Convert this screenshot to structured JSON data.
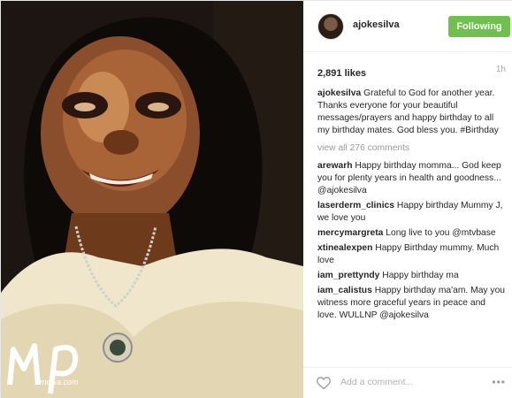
{
  "post": {
    "username": "ajokesilva",
    "follow_label": "Following",
    "likes": "2,891 likes",
    "time": "1h"
  },
  "caption": {
    "user": "ajokesilva",
    "text": "Grateful to God for another year. Thanks everyone for your beautiful messages/prayers and happy birthday to all my birthday mates. God bless you. #Birthday"
  },
  "view_all": "view all 276 comments",
  "comments": [
    {
      "user": "arewarh",
      "text": "Happy birthday momma... God keep you for plenty years in health and goodness... @ajokesilva"
    },
    {
      "user": "laserderm_clinics",
      "text": "Happy birthday Mummy J, we love you"
    },
    {
      "user": "mercymargreta",
      "text": "Long live to you @mtvbase"
    },
    {
      "user": "xtinealexpen",
      "text": "Happy Birthday mummy. Much love"
    },
    {
      "user": "iam_prettyndy",
      "text": "Happy birthday ma"
    },
    {
      "user": "iam_calistus",
      "text": "Happy birthday ma'am. May you witness more graceful years in peace and love. WULLNP @ajokesilva"
    }
  ],
  "footer": {
    "add_comment_placeholder": "Add a comment...",
    "more_label": "•••"
  },
  "watermark": {
    "logo_text": "mp",
    "sub_text": "mowa.com"
  },
  "colors": {
    "follow_button": "#70c050",
    "muted_text": "#999999"
  },
  "icons": {
    "like": "heart-outline-icon",
    "more": "ellipsis-icon"
  }
}
